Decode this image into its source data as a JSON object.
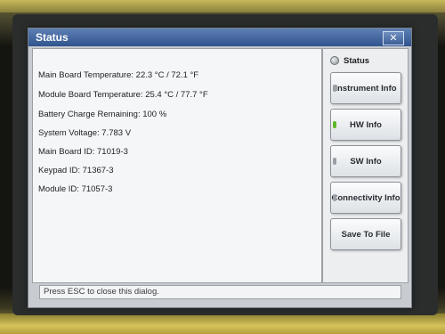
{
  "dialog": {
    "title": "Status",
    "close_label": "✕"
  },
  "info": {
    "lines": [
      "Main Board Temperature: 22.3 °C / 72.1 °F",
      "Module Board Temperature: 25.4 °C / 77.7 °F",
      "Battery Charge Remaining: 100 %",
      "System Voltage: 7.783 V",
      "Main Board ID: 71019-3",
      "Keypad ID: 71367-3",
      "Module ID: 71057-3"
    ]
  },
  "side_panel": {
    "status_label": "Status",
    "buttons": [
      {
        "label": "Instrument Info",
        "led": "off"
      },
      {
        "label": "HW Info",
        "led": "on"
      },
      {
        "label": "SW Info",
        "led": "off"
      },
      {
        "label": "Connectivity Info",
        "led": "off"
      },
      {
        "label": "Save To File",
        "led": "none"
      }
    ]
  },
  "statusbar": {
    "text": "Press ESC to close this dialog."
  }
}
